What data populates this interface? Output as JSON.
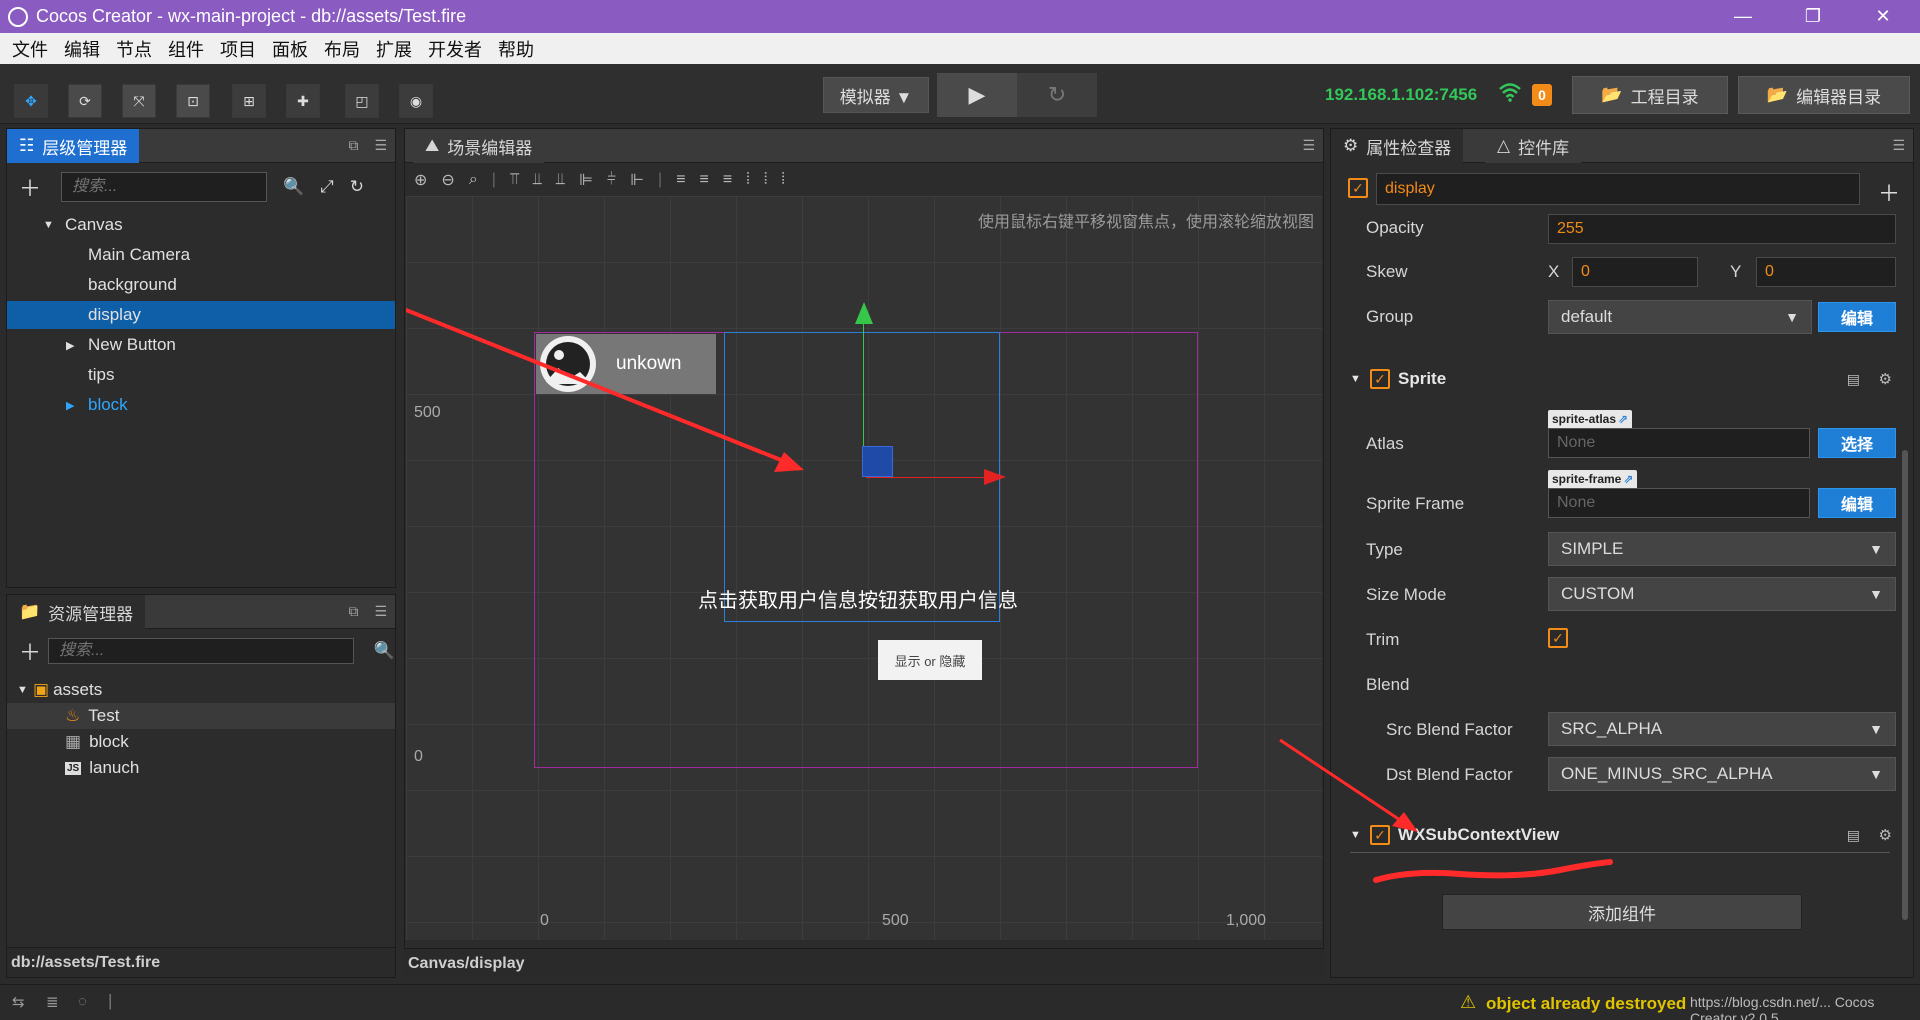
{
  "window": {
    "title": "Cocos Creator - wx-main-project - db://assets/Test.fire",
    "minimize_glyph": "—",
    "restore_glyph": "❐",
    "close_glyph": "✕"
  },
  "menu": [
    "文件",
    "编辑",
    "节点",
    "组件",
    "项目",
    "面板",
    "布局",
    "扩展",
    "开发者",
    "帮助"
  ],
  "toolbar": {
    "simulator_label": "模拟器 ▼",
    "play_glyph": "▶",
    "refresh_glyph": "↻",
    "ip": "192.168.1.102:7456",
    "badge": "0",
    "project_dir_label": "工程目录",
    "editor_dir_label": "编辑器目录"
  },
  "hierarchy": {
    "tab_label": "层级管理器",
    "search_placeholder": "搜索...",
    "nodes": [
      {
        "label": "Canvas",
        "arrow": "▼"
      },
      {
        "label": "Main Camera",
        "arrow": ""
      },
      {
        "label": "background",
        "arrow": ""
      },
      {
        "label": "display",
        "arrow": ""
      },
      {
        "label": "New Button",
        "arrow": "▶"
      },
      {
        "label": "tips",
        "arrow": ""
      },
      {
        "label": "block",
        "arrow": "▶"
      }
    ]
  },
  "assets": {
    "tab_label": "资源管理器",
    "search_placeholder": "搜索...",
    "root": "assets",
    "items": [
      "Test",
      "block",
      "lanuch"
    ],
    "path": "db://assets/Test.fire"
  },
  "scene": {
    "tab_label": "场景编辑器",
    "hint": "使用鼠标右键平移视窗焦点，使用滚轮缩放视图",
    "axis_y_500": "500",
    "axis_y_0": "0",
    "axis_x_0": "0",
    "axis_x_500": "500",
    "axis_x_1000": "1,000",
    "user_label": "unkown",
    "info_text": "点击获取用户信息按钮获取用户信息",
    "toggle_button_label": "显示 or 隐藏",
    "path": "Canvas/display"
  },
  "inspector": {
    "tab_label": "属性检查器",
    "tab2_label": "控件库",
    "node_name": "display",
    "opacity_label": "Opacity",
    "opacity_value": "255",
    "skew_label": "Skew",
    "skew_x_label": "X",
    "skew_x": "0",
    "skew_y_label": "Y",
    "skew_y": "0",
    "group_label": "Group",
    "group_value": "default",
    "edit_label": "编辑",
    "sprite_header": "Sprite",
    "atlas_label": "Atlas",
    "atlas_tag": "sprite-atlas",
    "atlas_value": "None",
    "select_label": "选择",
    "sprite_frame_label": "Sprite Frame",
    "sprite_frame_tag": "sprite-frame",
    "sprite_frame_value": "None",
    "type_label": "Type",
    "type_value": "SIMPLE",
    "size_mode_label": "Size Mode",
    "size_mode_value": "CUSTOM",
    "trim_label": "Trim",
    "blend_label": "Blend",
    "src_blend_label": "Src Blend Factor",
    "src_blend_value": "SRC_ALPHA",
    "dst_blend_label": "Dst Blend Factor",
    "dst_blend_value": "ONE_MINUS_SRC_ALPHA",
    "wx_header": "WXSubContextView",
    "add_component_label": "添加组件"
  },
  "status": {
    "warning": "object already destroyed",
    "right_text": "https://blog.csdn.net/... Cocos Creator v2.0.5"
  },
  "colors": {
    "titlebar": "#8a5cc2",
    "accent_blue": "#1f7fd6",
    "accent_orange": "#f28b17",
    "ip_green": "#33c75a",
    "annotation_red": "#ff2a2a"
  }
}
